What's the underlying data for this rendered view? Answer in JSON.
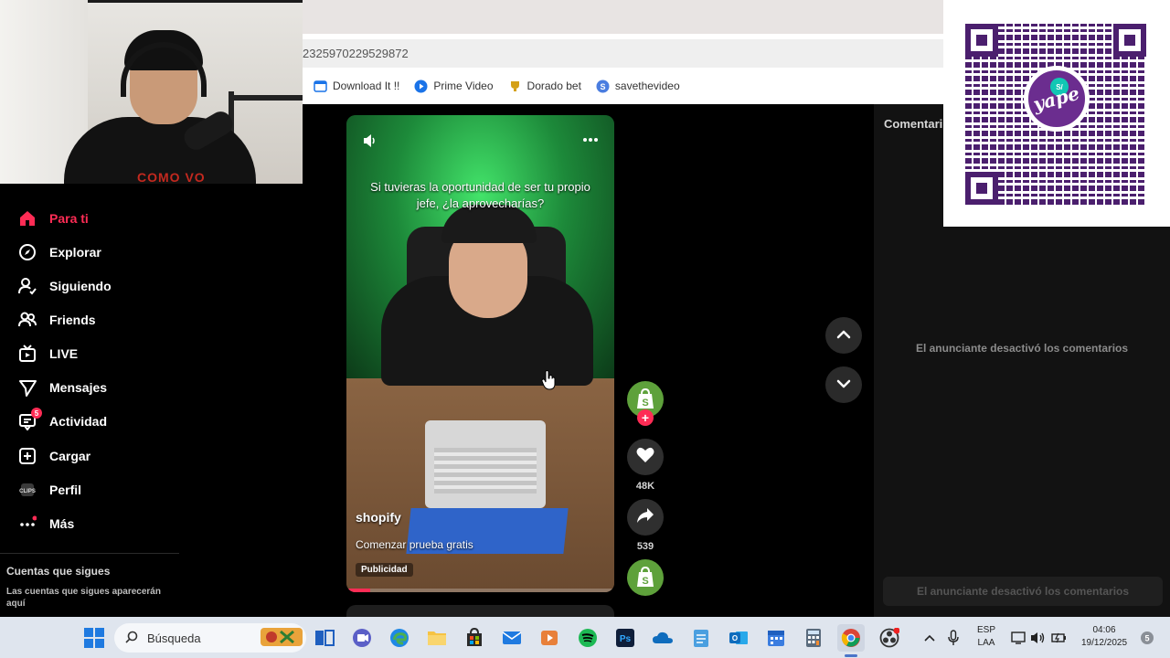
{
  "browser": {
    "address_fragment": "2325970229529872",
    "bookmarks": [
      "Download It !!",
      "Prime Video",
      "Dorado bet",
      "savethevideo"
    ]
  },
  "webcam": {
    "shirt_text": "COMO VO"
  },
  "sidebar": {
    "items": [
      {
        "label": "Para ti",
        "icon": "home-icon",
        "active": true
      },
      {
        "label": "Explorar",
        "icon": "compass-icon"
      },
      {
        "label": "Siguiendo",
        "icon": "user-follow-icon"
      },
      {
        "label": "Friends",
        "icon": "friends-icon"
      },
      {
        "label": "LIVE",
        "icon": "live-tv-icon"
      },
      {
        "label": "Mensajes",
        "icon": "send-icon"
      },
      {
        "label": "Actividad",
        "icon": "inbox-icon",
        "badge": "5"
      },
      {
        "label": "Cargar",
        "icon": "upload-icon"
      },
      {
        "label": "Perfil",
        "icon": "profile-icon"
      },
      {
        "label": "Más",
        "icon": "more-icon"
      }
    ],
    "follows_title": "Cuentas que sigues",
    "follows_desc": "Las cuentas que sigues aparecerán aquí"
  },
  "video": {
    "caption": "Si tuvieras la oportunidad de ser tu propio jefe, ¿la aprovecharías?",
    "username": "shopify",
    "cta": "Comenzar prueba gratis",
    "ad_label": "Publicidad",
    "progress": 0.09,
    "likes": "48K",
    "shares": "539"
  },
  "comments": {
    "title": "Comentari",
    "disabled_msg": "El anunciante desactivó los comentarios",
    "input_disabled": "El anunciante desactivó los comentarios"
  },
  "qr": {
    "brand": "yape",
    "badge": "S/"
  },
  "taskbar": {
    "search_label": "Búsqueda",
    "lang_top": "ESP",
    "lang_bottom": "LAA",
    "time": "04:06",
    "date": "19/12/2025"
  },
  "colors": {
    "accent": "#fe2c55",
    "shopify_green": "#5ea13b",
    "yape_purple": "#6b2d8f"
  }
}
